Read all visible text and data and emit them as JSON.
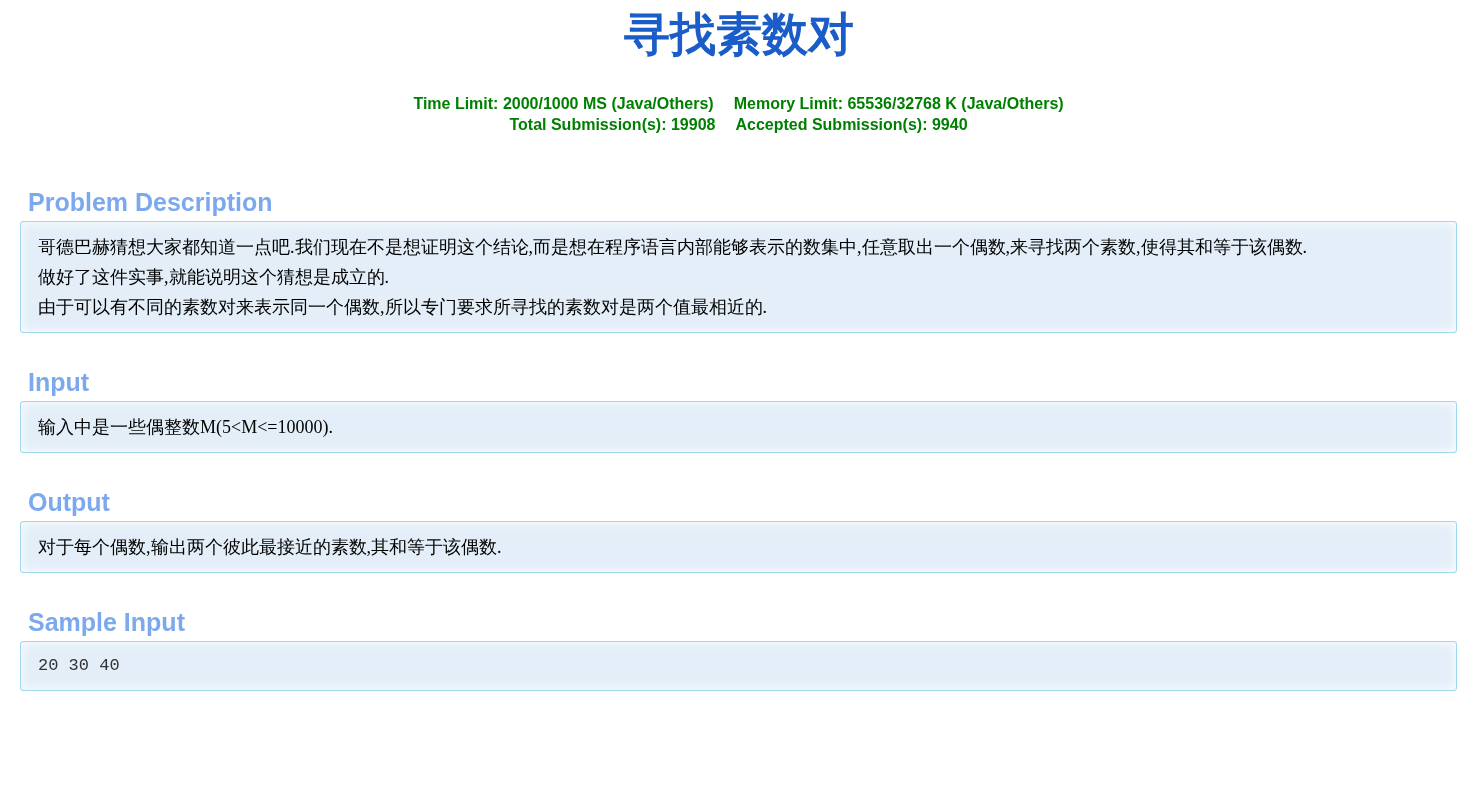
{
  "title": "寻找素数对",
  "limits": [
    [
      "Time Limit: 2000/1000 MS (Java/Others)",
      "Memory Limit: 65536/32768 K (Java/Others)"
    ],
    [
      "Total Submission(s): 19908",
      "Accepted Submission(s): 9940"
    ]
  ],
  "sections": [
    {
      "heading": "Problem Description",
      "kind": "text",
      "lines": [
        "哥德巴赫猜想大家都知道一点吧.我们现在不是想证明这个结论,而是想在程序语言内部能够表示的数集中,任意取出一个偶数,来寻找两个素数,使得其和等于该偶数.",
        "做好了这件实事,就能说明这个猜想是成立的.",
        "由于可以有不同的素数对来表示同一个偶数,所以专门要求所寻找的素数对是两个值最相近的."
      ]
    },
    {
      "heading": "Input",
      "kind": "text",
      "lines": [
        "输入中是一些偶整数M(5<M<=10000)."
      ]
    },
    {
      "heading": "Output",
      "kind": "text",
      "lines": [
        "对于每个偶数,输出两个彼此最接近的素数,其和等于该偶数."
      ]
    },
    {
      "heading": "Sample Input",
      "kind": "code",
      "lines": [
        "20 30 40"
      ]
    }
  ]
}
